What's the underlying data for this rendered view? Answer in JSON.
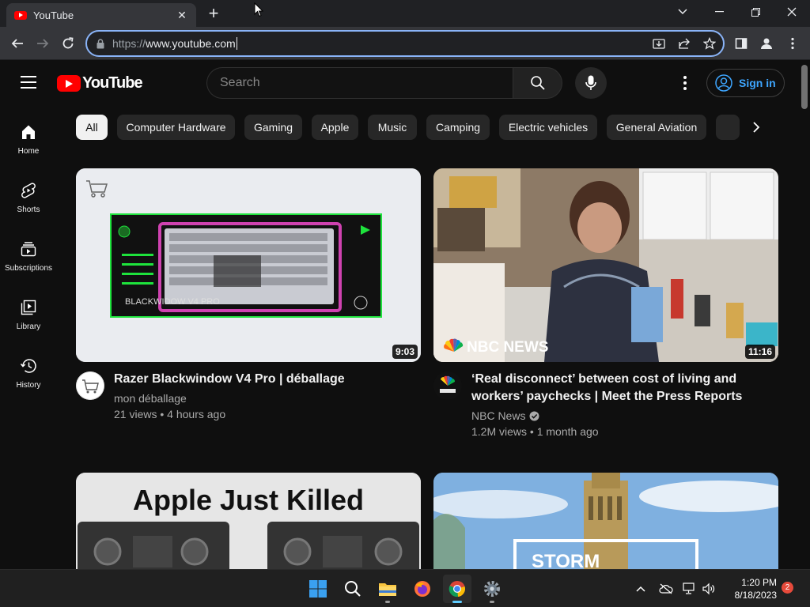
{
  "browser": {
    "tab_title": "YouTube",
    "url_scheme": "https://",
    "url_host": "www.youtube.com"
  },
  "youtube": {
    "logo_text": "YouTube",
    "search_placeholder": "Search",
    "sign_in_label": "Sign in",
    "sidebar": [
      {
        "label": "Home",
        "icon": "home-icon"
      },
      {
        "label": "Shorts",
        "icon": "shorts-icon"
      },
      {
        "label": "Subscriptions",
        "icon": "subscriptions-icon"
      },
      {
        "label": "Library",
        "icon": "library-icon"
      },
      {
        "label": "History",
        "icon": "history-icon"
      }
    ],
    "chips": [
      "All",
      "Computer Hardware",
      "Gaming",
      "Apple",
      "Music",
      "Camping",
      "Electric vehicles",
      "General Aviation"
    ],
    "videos": [
      {
        "title": "Razer Blackwindow V4 Pro | déballage",
        "channel": "mon déballage",
        "views": "21 views",
        "age": "4 hours ago",
        "duration": "9:03",
        "thumb_text": "BLACKWIDOW V4 PRO"
      },
      {
        "title_line1": "‘Real disconnect’ between cost of living and",
        "title_line2": "workers’ paychecks | Meet the Press Reports",
        "channel": "NBC News",
        "verified": true,
        "views": "1.2M views",
        "age": "1 month ago",
        "duration": "11:16",
        "thumb_text": "NBC NEWS"
      },
      {
        "thumb_text": "Apple Just Killed"
      },
      {
        "thumb_text": "STORM"
      }
    ]
  },
  "taskbar": {
    "time": "1:20 PM",
    "date": "8/18/2023",
    "notifications": "2"
  },
  "colors": {
    "accent_blue": "#3ea6ff",
    "youtube_red": "#ff0000",
    "omnibox_focus": "#8ab4f8"
  }
}
